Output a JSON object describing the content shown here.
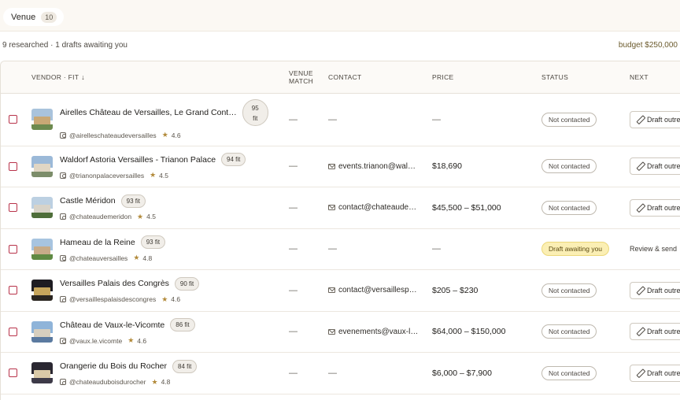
{
  "tab": {
    "label": "Venue",
    "count": "10"
  },
  "summary": "9 researched · 1 drafts awaiting you",
  "budget": "budget $250,000",
  "columns": {
    "vendor": "VENDOR · FIT",
    "sort_icon": "↓",
    "match_line1": "VENUE",
    "match_line2": "MATCH",
    "contact": "CONTACT",
    "price": "PRICE",
    "status": "STATUS",
    "next": "NEXT"
  },
  "icons": {
    "sort": "arrow-down-icon",
    "handle": "instagram-icon",
    "rating": "star-icon",
    "contact": "mail-icon",
    "action": "pencil-icon"
  },
  "colors": {
    "checkbox": "#b8334a",
    "draft_status_bg": "#fbefb4",
    "star": "#b28a3a"
  },
  "rows": [
    {
      "name": "Airelles Château de Versailles, Le Grand Cont…",
      "fit_num": "95",
      "fit_word": "fit",
      "handle": "@airelleschateaudeversailles",
      "star": "★",
      "rating": "4.6",
      "match": "—",
      "contact": "—",
      "price": "—",
      "status": "Not contacted",
      "next": "Draft outreach"
    },
    {
      "name": "Waldorf Astoria Versailles - Trianon Palace",
      "fit": "94 fit",
      "handle": "@trianonpalaceversailles",
      "star": "★",
      "rating": "4.5",
      "match": "—",
      "contact": "events.trianon@waldorfastoria.com",
      "price": "$18,690",
      "status": "Not contacted",
      "next": "Draft outreach"
    },
    {
      "name": "Castle Méridon",
      "fit": "93 fit",
      "handle": "@chateaudemeridon",
      "star": "★",
      "rating": "4.5",
      "match": "—",
      "contact": "contact@chateaudemeridon.com",
      "price": "$45,500 – $51,000",
      "status": "Not contacted",
      "next": "Draft outreach"
    },
    {
      "name": "Hameau de la Reine",
      "fit": "93 fit",
      "handle": "@chateauversailles",
      "star": "★",
      "rating": "4.8",
      "match": "—",
      "contact": "—",
      "price": "—",
      "status": "Draft awaiting you",
      "next": "Review & send"
    },
    {
      "name": "Versailles Palais des Congrès",
      "fit": "90 fit",
      "handle": "@versaillespalaisdescongres",
      "star": "★",
      "rating": "4.6",
      "match": "—",
      "contact": "contact@versaillespalaisdescongres.fr",
      "price": "$205 – $230",
      "status": "Not contacted",
      "next": "Draft outreach"
    },
    {
      "name": "Château de Vaux-le-Vicomte",
      "fit": "86 fit",
      "handle": "@vaux.le.vicomte",
      "star": "★",
      "rating": "4.6",
      "match": "—",
      "contact": "evenements@vaux-le-vicomte.com",
      "price": "$64,000 – $150,000",
      "status": "Not contacted",
      "next": "Draft outreach"
    },
    {
      "name": "Orangerie du Bois du Rocher",
      "fit": "84 fit",
      "handle": "@chateauduboisdurocher",
      "star": "★",
      "rating": "4.8",
      "match": "—",
      "contact": "—",
      "price": "$6,000 – $7,900",
      "status": "Not contacted",
      "next": "Draft outreach"
    }
  ]
}
